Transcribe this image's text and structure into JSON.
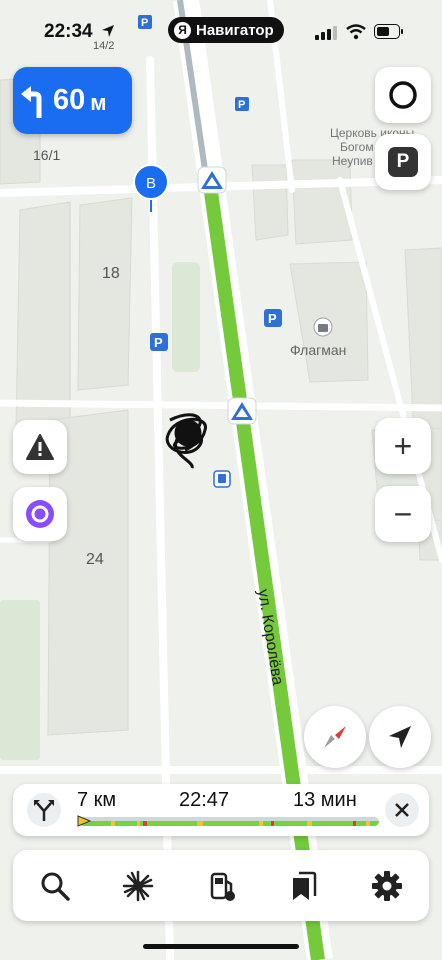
{
  "status_bar": {
    "time": "22:34",
    "app_name": "Навигатор",
    "app_logo_letter": "Я"
  },
  "maneuver": {
    "distance_value": "60",
    "distance_unit": "м"
  },
  "map": {
    "street_name": "ул. Королёва",
    "labels": [
      {
        "text": "14/2"
      },
      {
        "text": "16/1"
      },
      {
        "text": "18"
      },
      {
        "text": "24"
      },
      {
        "text": "Флагман"
      },
      {
        "text": "Церковь иконы"
      },
      {
        "text": "Богом"
      },
      {
        "text": "Неупив"
      }
    ],
    "waypoint_letter": "B",
    "parking_letter": "P",
    "route_color": "#79d13f",
    "pin_color": "#1a6cf0"
  },
  "side_buttons": {
    "parking_label": "P",
    "zoom_in": "+",
    "zoom_out": "−"
  },
  "route_info": {
    "distance": "7 км",
    "arrival_time": "22:47",
    "duration": "13 мин"
  },
  "tabs": [
    {
      "icon": "search-icon"
    },
    {
      "icon": "speedcam-icon"
    },
    {
      "icon": "gas-station-icon"
    },
    {
      "icon": "bookmarks-icon"
    },
    {
      "icon": "settings-icon"
    }
  ]
}
